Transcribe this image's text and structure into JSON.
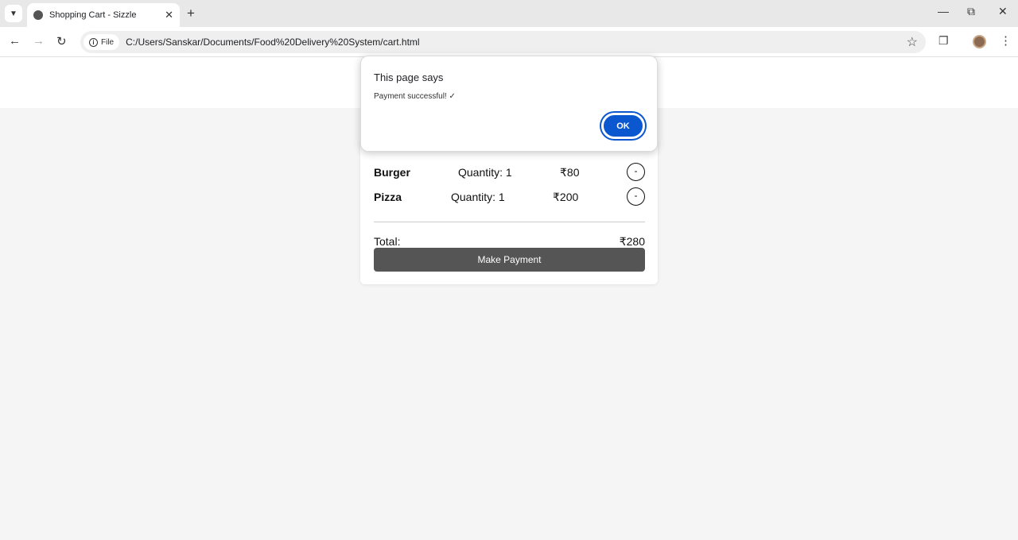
{
  "browser": {
    "tab_title": "Shopping Cart - Sizzle",
    "address_chip": "File",
    "url": "C:/Users/Sanskar/Documents/Food%20Delivery%20System/cart.html"
  },
  "cart": {
    "items": [
      {
        "name": "Burger",
        "quantity": "Quantity: 1",
        "price": "₹80",
        "remove": "-"
      },
      {
        "name": "Pizza",
        "quantity": "Quantity: 1",
        "price": "₹200",
        "remove": "-"
      }
    ],
    "total_label": "Total:",
    "total_value": "₹280",
    "pay_label": "Make Payment"
  },
  "dialog": {
    "title": "This page says",
    "message": "Payment successful! ✓",
    "ok_label": "OK"
  },
  "colors": {
    "ok_button": "#0b57d0",
    "pay_button": "#555555",
    "page_bg": "#f5f5f5"
  }
}
